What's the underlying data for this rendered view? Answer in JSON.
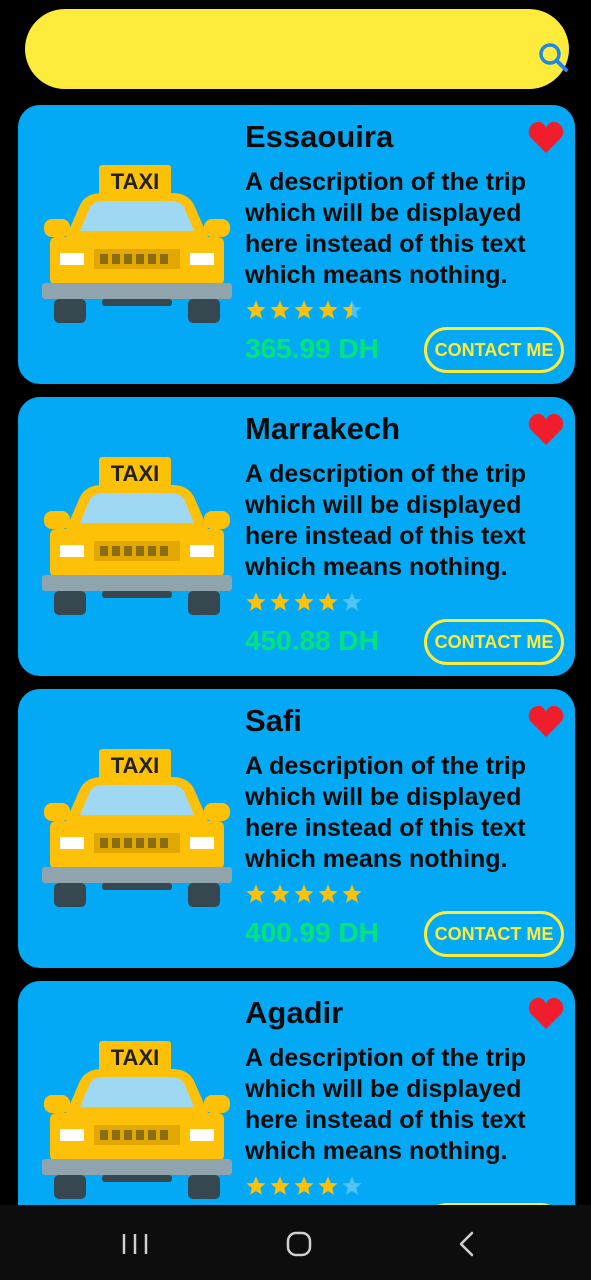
{
  "search": {
    "placeholder": "",
    "value": "",
    "icon": "search-icon"
  },
  "colors": {
    "search_bg": "#FFEB3B",
    "card_bg": "#03A9F4",
    "price": "#00E676",
    "button_border": "#FFEB3B",
    "star": "#FFC107",
    "heart": "#F01E2C"
  },
  "trips": [
    {
      "city": "Essaouira",
      "description": "A description of the trip which will be displayed here instead of this text which means nothing.",
      "rating": 4.5,
      "price": "365.99 DH",
      "contact_label": "CONTACT ME",
      "taxi_sign": "TAXI",
      "favorite": true
    },
    {
      "city": "Marrakech",
      "description": "A description of the trip which will be displayed here instead of this text which means nothing.",
      "rating": 4,
      "price": "450.88 DH",
      "contact_label": "CONTACT ME",
      "taxi_sign": "TAXI",
      "favorite": true
    },
    {
      "city": "Safi",
      "description": "A description of the trip which will be displayed here instead of this text which means nothing.",
      "rating": 5,
      "price": "400.99 DH",
      "contact_label": "CONTACT ME",
      "taxi_sign": "TAXI",
      "favorite": true
    },
    {
      "city": "Agadir",
      "description": "A description of the trip which will be displayed here instead of this text which means nothing.",
      "rating": 4,
      "price": "",
      "contact_label": "",
      "taxi_sign": "TAXI",
      "favorite": true
    }
  ],
  "nav": {
    "recents": "recents-icon",
    "home": "home-icon",
    "back": "back-icon"
  }
}
